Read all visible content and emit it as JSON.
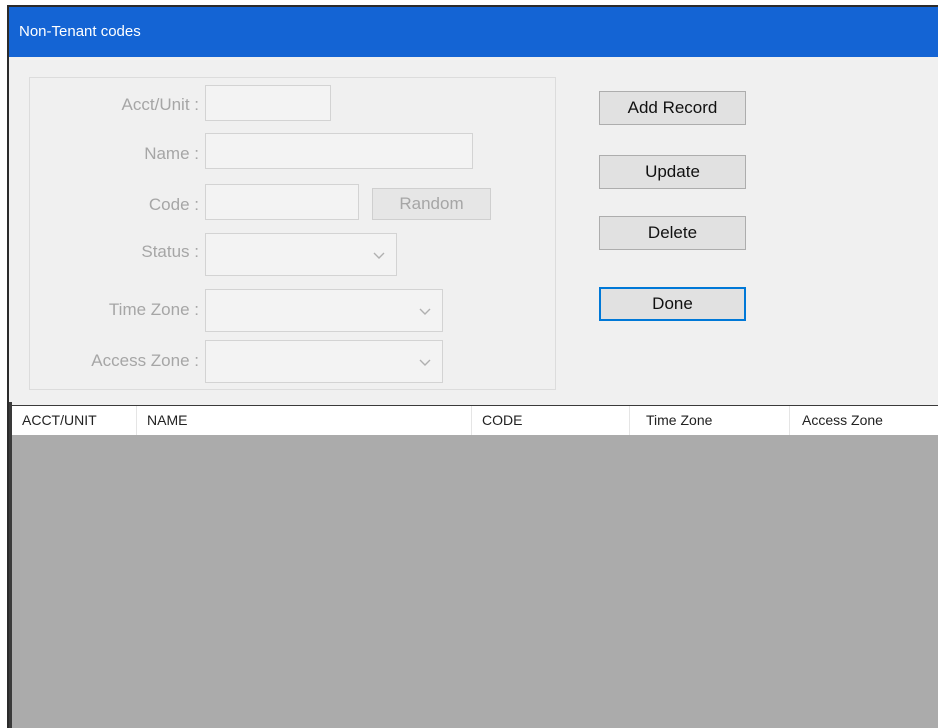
{
  "window": {
    "title": "Non-Tenant codes"
  },
  "form": {
    "acct_label": "Acct/Unit :",
    "name_label": "Name :",
    "code_label": "Code :",
    "random_label": "Random",
    "status_label": "Status :",
    "timezone_label": "Time Zone :",
    "accesszone_label": "Access Zone :"
  },
  "buttons": {
    "add_record": "Add Record",
    "update": "Update",
    "delete": "Delete",
    "done": "Done"
  },
  "grid": {
    "columns": [
      "ACCT/UNIT",
      "NAME",
      "CODE",
      "Time Zone",
      "Access Zone"
    ]
  },
  "icons": {
    "combo_arrow": "chevron-down-icon"
  },
  "colors": {
    "titlebar": "#1464d4",
    "grid_empty": "#ababab"
  }
}
